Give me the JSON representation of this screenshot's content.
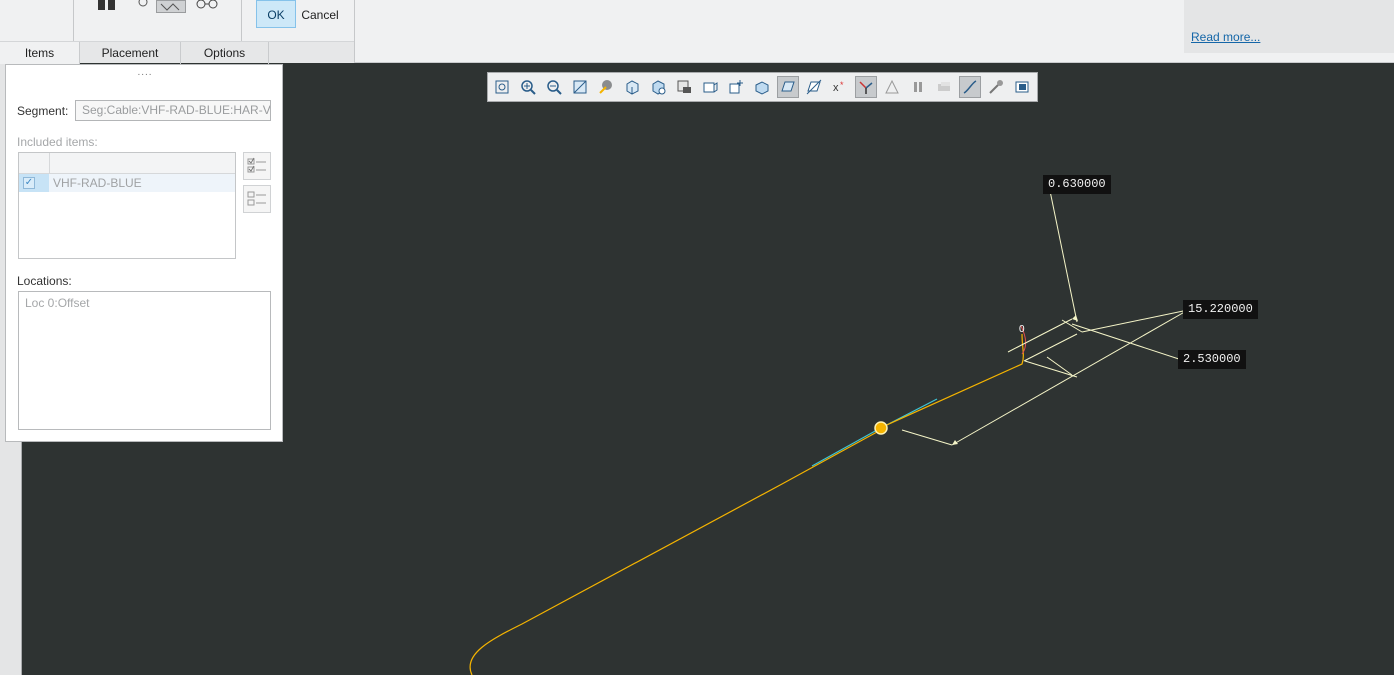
{
  "ribbon": {
    "ok_label": "OK",
    "cancel_label": "Cancel",
    "read_more": "Read more...",
    "tabs": [
      {
        "label": "Items"
      },
      {
        "label": "Placement"
      },
      {
        "label": "Options"
      }
    ]
  },
  "panel": {
    "grip": "....",
    "segment_label": "Segment:",
    "segment_value": "Seg:Cable:VHF-RAD-BLUE:HAR-VH",
    "included_label": "Included items:",
    "included_items": [
      {
        "label": "VHF-RAD-BLUE",
        "checked": true
      }
    ],
    "locations_label": "Locations:",
    "locations": [
      "Loc 0:Offset"
    ]
  },
  "graphics_toolbar": {
    "icons": [
      "refit-icon",
      "zoom-in-icon",
      "zoom-out-icon",
      "repaint-icon",
      "display-style-icon",
      "saved-orientations-icon",
      "named-views-icon",
      "view-manager-icon",
      "perspective-icon",
      "spin-center-icon",
      "annotation-display-icon",
      "plane-display-icon",
      "axis-display-icon",
      "point-display-icon",
      "csys-display-icon",
      "pause-icon",
      "section-icon",
      "curve-display-icon",
      "cable-display-icon",
      "3d-note-icon"
    ],
    "active": [
      "plane-display-icon",
      "csys-display-icon",
      "curve-display-icon"
    ]
  },
  "canvas": {
    "background": "#2e3332",
    "cable_color": "#f5b400",
    "dimension_color": "#f5f5c8",
    "dimensions": [
      "0.630000",
      "15.220000",
      "2.530000"
    ]
  }
}
